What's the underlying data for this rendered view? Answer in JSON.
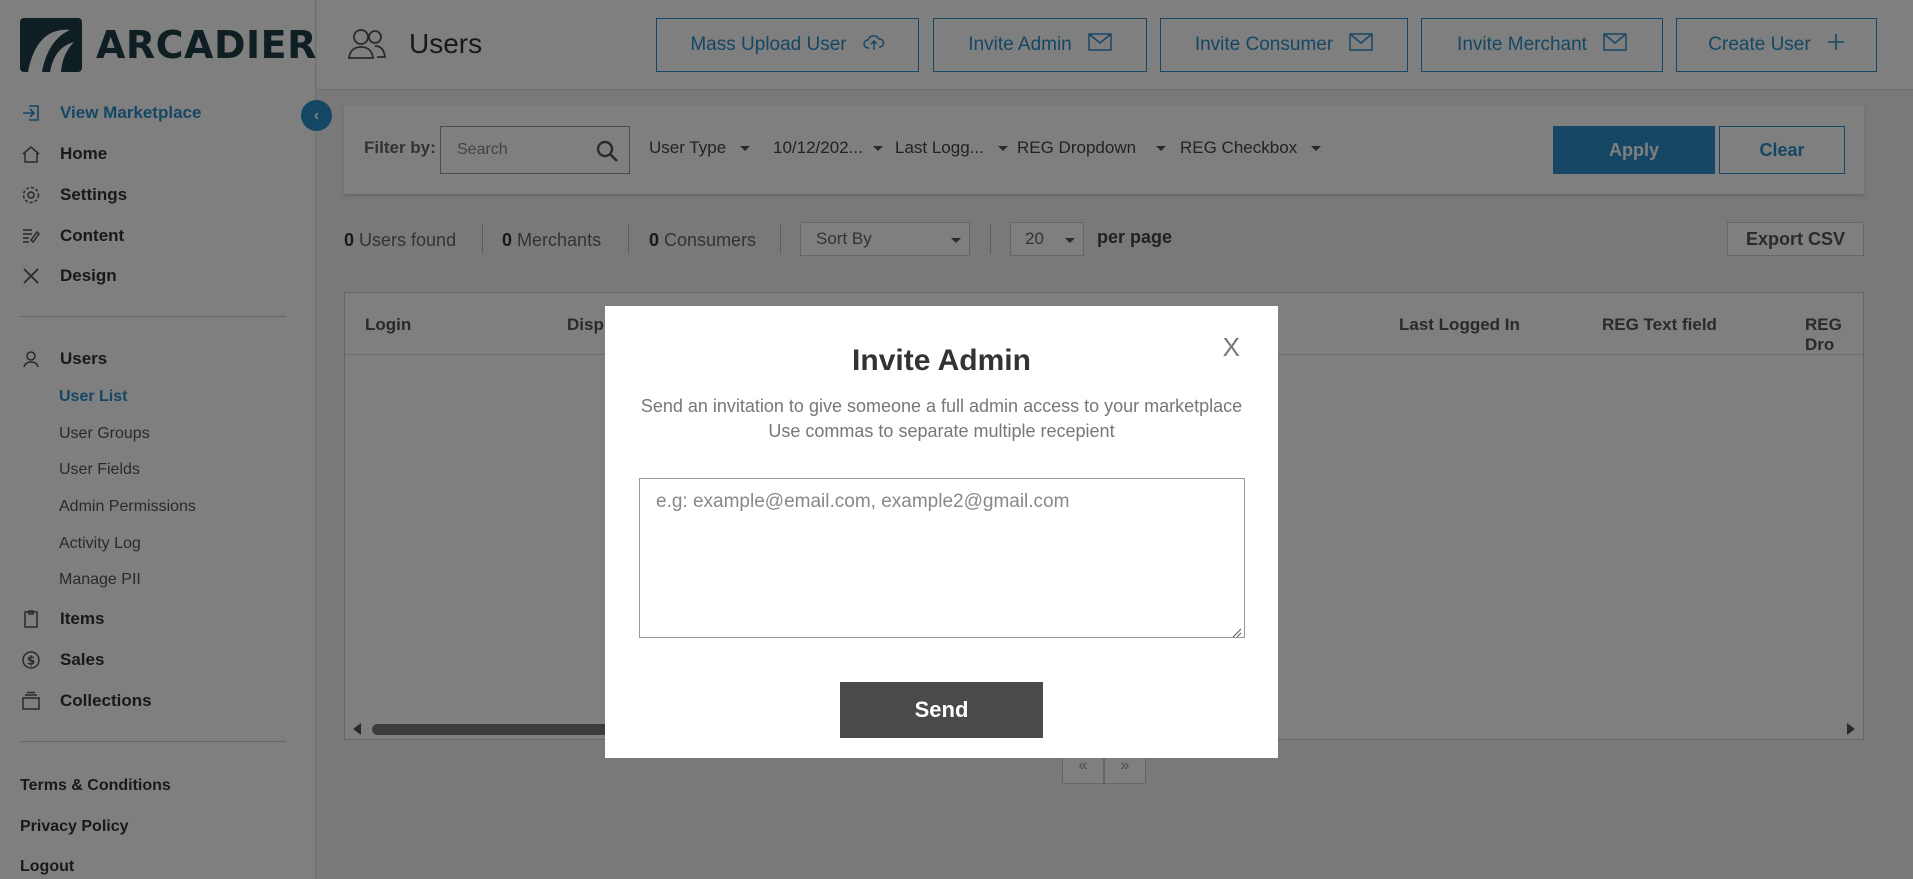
{
  "brand": {
    "name": "ARCADIER",
    "accent": "#2b8fca",
    "dark": "#1f3d47"
  },
  "sidebar": {
    "view_marketplace": "View Marketplace",
    "main_items": [
      {
        "label": "Home",
        "icon": "home-icon"
      },
      {
        "label": "Settings",
        "icon": "gear-icon"
      },
      {
        "label": "Content",
        "icon": "content-icon"
      },
      {
        "label": "Design",
        "icon": "design-icon"
      }
    ],
    "users_label": "Users",
    "user_sub_items": [
      "User List",
      "User Groups",
      "User Fields",
      "Admin Permissions",
      "Activity Log",
      "Manage PII"
    ],
    "lower_items": [
      {
        "label": "Items",
        "icon": "clipboard-icon"
      },
      {
        "label": "Sales",
        "icon": "dollar-icon"
      },
      {
        "label": "Collections",
        "icon": "collections-icon"
      }
    ],
    "footer_links": [
      "Terms & Conditions",
      "Privacy Policy",
      "Logout"
    ]
  },
  "header": {
    "title": "Users",
    "buttons": [
      "Mass Upload User",
      "Invite Admin",
      "Invite Consumer",
      "Invite Merchant",
      "Create User"
    ]
  },
  "filters": {
    "label": "Filter by:",
    "search_placeholder": "Search",
    "dropdowns": [
      "User Type",
      "10/12/202...",
      "Last Logg...",
      "REG Dropdown",
      "REG Checkbox"
    ],
    "apply": "Apply",
    "clear": "Clear"
  },
  "stats": {
    "users_count": "0",
    "users_label": "Users found",
    "merchants_count": "0",
    "merchants_label": "Merchants",
    "consumers_count": "0",
    "consumers_label": "Consumers",
    "sort_by": "Sort By",
    "per_page_value": "20",
    "per_page_label": "per page",
    "export": "Export CSV"
  },
  "table": {
    "columns": [
      "Login",
      "Displ",
      "Last Logged In",
      "REG Text field",
      "REG Dro"
    ]
  },
  "pager": {
    "prev": "«",
    "next": "»"
  },
  "modal": {
    "close": "X",
    "title": "Invite Admin",
    "desc_line1": "Send an invitation to give someone a full admin access to your marketplace",
    "desc_line2": "Use commas to separate multiple recepient",
    "placeholder": "e.g: example@email.com, example2@gmail.com",
    "send": "Send"
  }
}
